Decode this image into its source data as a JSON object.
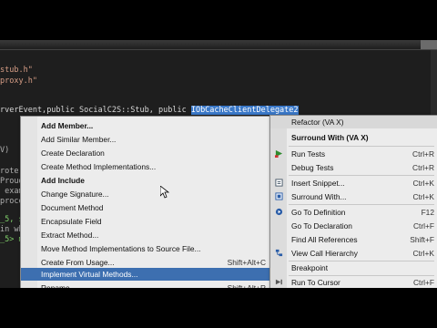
{
  "editor": {
    "lines": [
      {
        "text": "stub.h\""
      },
      {
        "text": "proxy.h\""
      },
      {
        "pre": "rverEvent,",
        "mid": "public SocialC2S::Stub, public ",
        "hl": "IObCacheClientDelegate2"
      },
      {
        "text": "V)"
      },
      {
        "text": "rote"
      },
      {
        "text": "Proud"
      },
      {
        "text": " exam"
      },
      {
        "text": "proce"
      },
      {
        "text": "_5, s"
      },
      {
        "text": "in wh"
      },
      {
        "text": "_5> m"
      }
    ]
  },
  "context_menu": {
    "items": [
      {
        "label": "Add Member...",
        "shortcut": ""
      },
      {
        "label": "Add Similar Member...",
        "shortcut": ""
      },
      {
        "label": "Create Declaration",
        "shortcut": ""
      },
      {
        "label": "Create Method Implementations...",
        "shortcut": ""
      },
      {
        "label": "Add Include",
        "shortcut": ""
      },
      {
        "label": "Change Signature...",
        "shortcut": ""
      },
      {
        "label": "Document Method",
        "shortcut": ""
      },
      {
        "label": "Encapsulate Field",
        "shortcut": ""
      },
      {
        "label": "Extract Method...",
        "shortcut": ""
      },
      {
        "label": "Move Method Implementations to Source File...",
        "shortcut": ""
      },
      {
        "label": "Create From Usage...",
        "shortcut": "Shift+Alt+C"
      },
      {
        "label": "Implement Virtual Methods...",
        "shortcut": ""
      },
      {
        "label": "Rename...",
        "shortcut": "Shift+Alt+R"
      }
    ]
  },
  "main_menu": {
    "header": "Refactor (VA X)",
    "items": [
      {
        "label": "Surround With (VA X)",
        "shortcut": "",
        "icon": "none"
      },
      {
        "label": "Run Tests",
        "shortcut": "Ctrl+R",
        "icon": "run-tests-icon"
      },
      {
        "label": "Debug Tests",
        "shortcut": "Ctrl+R",
        "icon": "none"
      },
      {
        "label": "Insert Snippet...",
        "shortcut": "Ctrl+K",
        "icon": "snippet-icon"
      },
      {
        "label": "Surround With...",
        "shortcut": "Ctrl+K",
        "icon": "surround-icon"
      },
      {
        "label": "Go To Definition",
        "shortcut": "F12",
        "icon": "goto-definition-icon"
      },
      {
        "label": "Go To Declaration",
        "shortcut": "Ctrl+F",
        "icon": "none"
      },
      {
        "label": "Find All References",
        "shortcut": "Shift+F",
        "icon": "none"
      },
      {
        "label": "View Call Hierarchy",
        "shortcut": "Ctrl+K",
        "icon": "call-hierarchy-icon"
      },
      {
        "label": "Breakpoint",
        "shortcut": "",
        "icon": "none"
      },
      {
        "label": "Run To Cursor",
        "shortcut": "Ctrl+F",
        "icon": "run-cursor-icon"
      }
    ]
  },
  "colors": {
    "selection": "#3d6fb0",
    "code_highlight": "#3a78c8",
    "menu_bg": "#ececec"
  }
}
